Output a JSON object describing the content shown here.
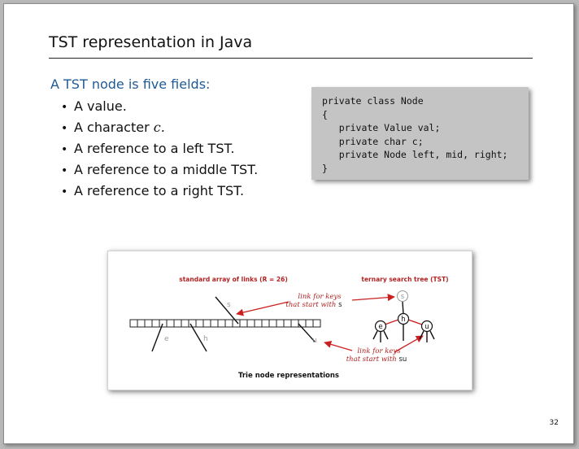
{
  "slide": {
    "title": "TST representation in Java",
    "lead": "A TST node is five fields:",
    "bullets": [
      {
        "dot": "•",
        "text": "A value.",
        "ital": ""
      },
      {
        "dot": "•",
        "text": "A character ",
        "ital": "c."
      },
      {
        "dot": "•",
        "text": "A reference to a left TST.",
        "ital": ""
      },
      {
        "dot": "•",
        "text": "A reference to a middle TST.",
        "ital": ""
      },
      {
        "dot": "•",
        "text": "A reference to a right TST.",
        "ital": ""
      }
    ],
    "code": "private class Node\n{\n   private Value val;\n   private char c;\n   private Node left, mid, right;\n}",
    "page_number": "32"
  },
  "figure": {
    "left_heading": "standard array of links (R = 26)",
    "right_heading": "ternary search tree (TST)",
    "callout_s_line1": "link for keys",
    "callout_s_line2": "that start with ",
    "callout_s_key": "s",
    "callout_su_line1": "link for keys",
    "callout_su_line2": "that start with ",
    "callout_su_key": "su",
    "array_letters": {
      "s": "s",
      "e": "e",
      "h": "h",
      "u": "u"
    },
    "tree_nodes": {
      "top": "s",
      "middle": "h",
      "left": "e",
      "right": "u"
    },
    "caption": "Trie node representations",
    "colors": {
      "callout": "#b22222",
      "arrow": "#cc1f1f",
      "ghost": "#9a9a9a"
    }
  }
}
